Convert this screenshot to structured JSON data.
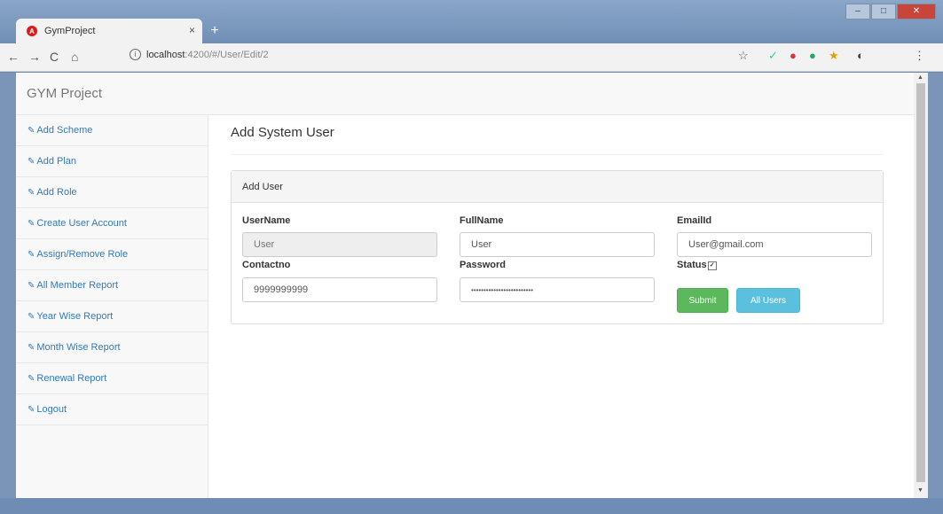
{
  "browser": {
    "tab_title": "GymProject",
    "tab_close": "×",
    "new_tab": "+",
    "url_host": "localhost",
    "url_path": ":4200/#/User/Edit/2",
    "nav": {
      "back": "←",
      "forward": "→",
      "reload": "C",
      "home": "⌂"
    }
  },
  "app": {
    "brand": "GYM Project"
  },
  "sidebar": {
    "items": [
      {
        "label": "Add Scheme"
      },
      {
        "label": "Add Plan"
      },
      {
        "label": "Add Role"
      },
      {
        "label": "Create User Account"
      },
      {
        "label": "Assign/Remove Role"
      },
      {
        "label": "All Member Report"
      },
      {
        "label": "Year Wise Report"
      },
      {
        "label": "Month Wise Report"
      },
      {
        "label": "Renewal Report"
      },
      {
        "label": "Logout"
      }
    ]
  },
  "main": {
    "title": "Add System User",
    "panel_heading": "Add User",
    "fields": {
      "username": {
        "label": "UserName",
        "value": "User"
      },
      "fullname": {
        "label": "FullName",
        "value": "User"
      },
      "emailid": {
        "label": "EmailId",
        "value": "User@gmail.com"
      },
      "contactno": {
        "label": "Contactno",
        "value": "9999999999"
      },
      "password": {
        "label": "Password",
        "value": "•••••••••••••••••••••••••"
      },
      "status": {
        "label": "Status",
        "checked": true
      }
    },
    "buttons": {
      "submit": "Submit",
      "all_users": "All Users"
    }
  },
  "colors": {
    "link": "#337ab7",
    "submit": "#5cb85c",
    "all_users": "#5bc0de"
  }
}
